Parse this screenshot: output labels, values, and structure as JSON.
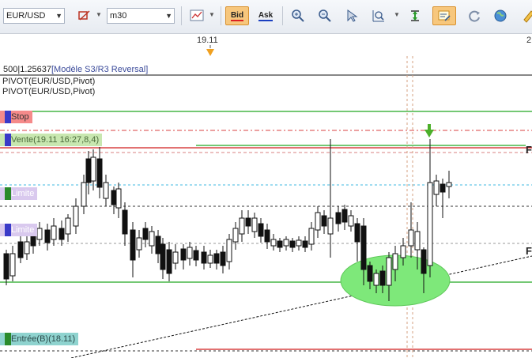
{
  "toolbar": {
    "symbol": "EUR/USD",
    "timeframe": "m30",
    "bid_label": "Bid",
    "ask_label": "Ask"
  },
  "time_axis": {
    "labels": [
      "19.11",
      "2"
    ]
  },
  "indicators": {
    "line1": "500|1.25637",
    "line1b": "[Modèle S3/R3 Reversal]",
    "line2": "PIVOT(EUR/USD,Pivot)",
    "line3": "PIVOT(EUR/USD,Pivot)"
  },
  "order_tags": {
    "stop": "Stop",
    "vente": "Vente(19.11 16:27,8,4)",
    "limite1": "Limite",
    "limite2": "Limite",
    "entree": "Entrée(B)(18.11)"
  },
  "right_labels": [
    "F",
    "F"
  ],
  "colors": {
    "stop_line": "#d11d1d",
    "green_line": "#22a822",
    "limit_line": "#3fb8e0",
    "highlight": "#7ee87a",
    "arrow": "#4caf2a"
  }
}
